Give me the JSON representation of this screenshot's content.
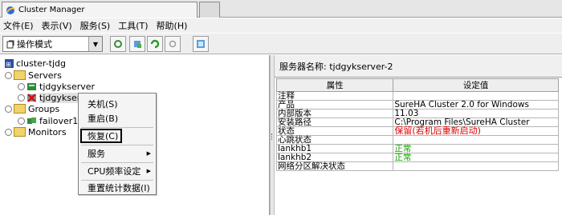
{
  "window": {
    "title": "Cluster Manager"
  },
  "menubar": {
    "items": [
      "文件(E)",
      "表示(V)",
      "服务(S)",
      "工具(T)",
      "帮助(H)"
    ]
  },
  "toolbar": {
    "mode_select": {
      "value": "操作模式"
    }
  },
  "tree": {
    "root": "cluster-tjdg",
    "servers_label": "Servers",
    "server1": "tjdgykserver",
    "server2": "tjdgykserv",
    "groups_label": "Groups",
    "group1": "failover1",
    "monitors_label": "Monitors"
  },
  "context_menu": {
    "shutdown": "关机(S)",
    "restart": "重启(B)",
    "restore": "恢复(C)",
    "service": "服务",
    "cpu": "CPU频率设定",
    "reset_stats": "重置统计数据(I)"
  },
  "detail": {
    "server_name": "服务器名称: tjdgykserver-2",
    "columns": [
      "属性",
      "设定值"
    ],
    "rows": [
      [
        "注释",
        ""
      ],
      [
        "产品",
        "SureHA Cluster 2.0 for Windows"
      ],
      [
        "内部版本",
        "11.03"
      ],
      [
        "安装路径",
        "C:\\Program Files\\SureHA Cluster"
      ],
      [
        "状态",
        "保留(若机后重新启动)"
      ],
      [
        "心跳状态",
        ""
      ],
      [
        "lankhb1",
        "正常"
      ],
      [
        "lankhb2",
        "正常"
      ],
      [
        "网络分区解决状态",
        ""
      ]
    ]
  },
  "colors": {
    "status_red": "#e00000",
    "ok_green": "#14a000"
  }
}
